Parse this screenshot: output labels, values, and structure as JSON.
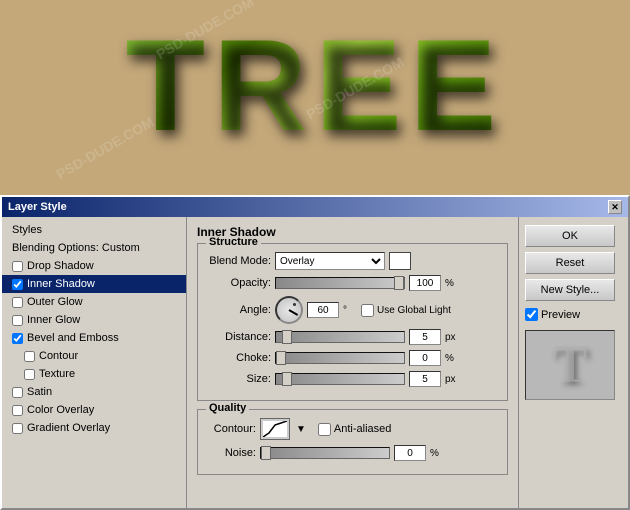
{
  "canvas": {
    "tree_text": "TREE",
    "bg_color": "#c4a87a"
  },
  "dialog": {
    "title": "Layer Style",
    "close_label": "✕",
    "left_panel": {
      "items": [
        {
          "label": "Styles",
          "has_checkbox": false,
          "checked": false,
          "selected": false
        },
        {
          "label": "Blending Options: Custom",
          "has_checkbox": false,
          "checked": false,
          "selected": false
        },
        {
          "label": "Drop Shadow",
          "has_checkbox": true,
          "checked": false,
          "selected": false
        },
        {
          "label": "Inner Shadow",
          "has_checkbox": true,
          "checked": true,
          "selected": true
        },
        {
          "label": "Outer Glow",
          "has_checkbox": true,
          "checked": false,
          "selected": false
        },
        {
          "label": "Inner Glow",
          "has_checkbox": true,
          "checked": false,
          "selected": false
        },
        {
          "label": "Bevel and Emboss",
          "has_checkbox": true,
          "checked": true,
          "selected": false
        },
        {
          "label": "Contour",
          "has_checkbox": true,
          "checked": false,
          "selected": false,
          "indent": true
        },
        {
          "label": "Texture",
          "has_checkbox": true,
          "checked": false,
          "selected": false,
          "indent": true
        },
        {
          "label": "Satin",
          "has_checkbox": true,
          "checked": false,
          "selected": false
        },
        {
          "label": "Color Overlay",
          "has_checkbox": true,
          "checked": false,
          "selected": false
        },
        {
          "label": "Gradient Overlay",
          "has_checkbox": true,
          "checked": false,
          "selected": false
        }
      ]
    },
    "main": {
      "section_title": "Inner Shadow",
      "structure_title": "Structure",
      "blend_mode_label": "Blend Mode:",
      "blend_mode_value": "Overlay",
      "opacity_label": "Opacity:",
      "opacity_value": "100",
      "opacity_unit": "%",
      "angle_label": "Angle:",
      "angle_value": "60",
      "angle_unit": "°",
      "global_light_label": "Use Global Light",
      "distance_label": "Distance:",
      "distance_value": "5",
      "distance_unit": "px",
      "choke_label": "Choke:",
      "choke_value": "0",
      "choke_unit": "%",
      "size_label": "Size:",
      "size_value": "5",
      "size_unit": "px",
      "quality_title": "Quality",
      "contour_label": "Contour:",
      "anti_alias_label": "Anti-aliased",
      "noise_label": "Noise:",
      "noise_value": "0",
      "noise_unit": "%"
    },
    "right_panel": {
      "ok_label": "OK",
      "reset_label": "Reset",
      "new_style_label": "New Style...",
      "preview_label": "Preview",
      "preview_char": "T"
    }
  }
}
